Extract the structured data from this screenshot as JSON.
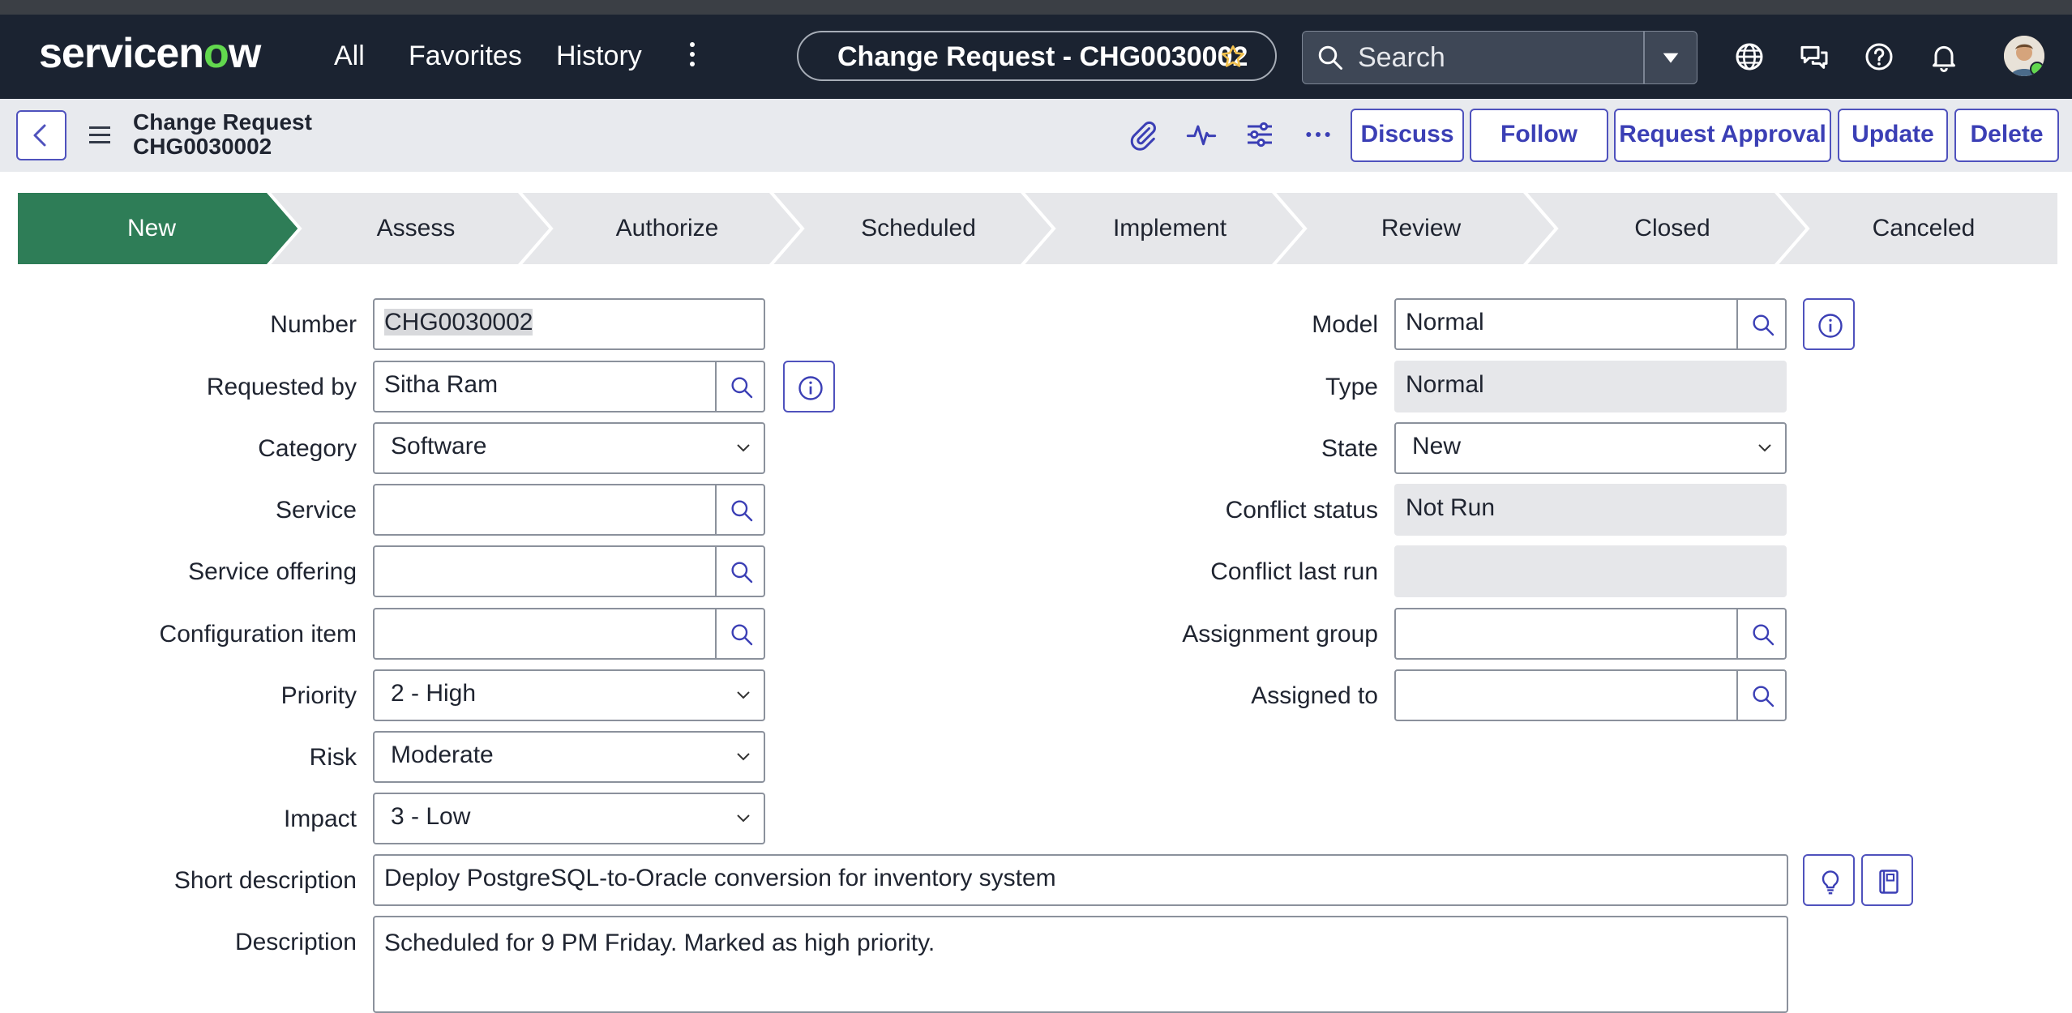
{
  "nav": {
    "logo": {
      "main": "servicen",
      "accent": "o",
      "tail": "w"
    },
    "links": [
      "All",
      "Favorites",
      "History"
    ],
    "record_title": "Change Request - CHG0030002",
    "search_placeholder": "Search"
  },
  "header": {
    "title_line1": "Change Request",
    "title_line2": "CHG0030002",
    "buttons": {
      "discuss": "Discuss",
      "follow": "Follow",
      "request_approval": "Request Approval",
      "update": "Update",
      "delete": "Delete"
    }
  },
  "stages": {
    "items": [
      "New",
      "Assess",
      "Authorize",
      "Scheduled",
      "Implement",
      "Review",
      "Closed",
      "Canceled"
    ],
    "active": "New",
    "active_color": "#2e7d57",
    "inactive_color": "#e6e7ea"
  },
  "form": {
    "number": {
      "label": "Number",
      "value": "CHG0030002"
    },
    "requested_by": {
      "label": "Requested by",
      "value": "Sitha Ram"
    },
    "category": {
      "label": "Category",
      "value": "Software"
    },
    "service": {
      "label": "Service",
      "value": ""
    },
    "service_offering": {
      "label": "Service offering",
      "value": ""
    },
    "configuration_item": {
      "label": "Configuration item",
      "value": ""
    },
    "priority": {
      "label": "Priority",
      "value": "2 - High"
    },
    "risk": {
      "label": "Risk",
      "value": "Moderate"
    },
    "impact": {
      "label": "Impact",
      "value": "3 - Low"
    },
    "model": {
      "label": "Model",
      "value": "Normal"
    },
    "type": {
      "label": "Type",
      "value": "Normal"
    },
    "state": {
      "label": "State",
      "value": "New"
    },
    "conflict_status": {
      "label": "Conflict status",
      "value": "Not Run"
    },
    "conflict_last_run": {
      "label": "Conflict last run",
      "value": ""
    },
    "assignment_group": {
      "label": "Assignment group",
      "value": ""
    },
    "assigned_to": {
      "label": "Assigned to",
      "value": ""
    },
    "short_description": {
      "label": "Short description",
      "value": "Deploy PostgreSQL-to-Oracle conversion for inventory system"
    },
    "description": {
      "label": "Description",
      "value": "Scheduled for 9 PM Friday. Marked as high priority."
    }
  },
  "colors": {
    "nav_bg": "#1b2331",
    "accent": "#4f52bd",
    "stage_active": "#2e7d57",
    "brand_green": "#62d84e"
  }
}
